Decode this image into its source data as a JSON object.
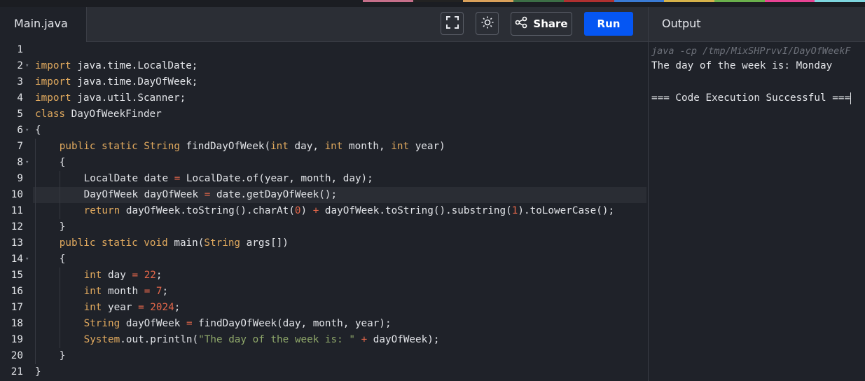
{
  "editor": {
    "file_tab": "Main.java",
    "buttons": {
      "fullscreen_icon": "fullscreen-icon",
      "theme_icon": "sun-icon",
      "share_label": "Share",
      "run_label": "Run"
    },
    "active_line": 10,
    "lines": [
      {
        "n": "1",
        "fold": false,
        "indent": 0,
        "tokens": []
      },
      {
        "n": "2",
        "fold": true,
        "indent": 0,
        "tokens": [
          [
            "kw",
            "import"
          ],
          [
            "t",
            " java.time.LocalDate;"
          ]
        ]
      },
      {
        "n": "3",
        "fold": false,
        "indent": 0,
        "tokens": [
          [
            "kw",
            "import"
          ],
          [
            "t",
            " java.time.DayOfWeek;"
          ]
        ]
      },
      {
        "n": "4",
        "fold": false,
        "indent": 0,
        "tokens": [
          [
            "kw",
            "import"
          ],
          [
            "t",
            " java.util.Scanner;"
          ]
        ]
      },
      {
        "n": "5",
        "fold": false,
        "indent": 0,
        "tokens": [
          [
            "kw",
            "class"
          ],
          [
            "t",
            " DayOfWeekFinder"
          ]
        ]
      },
      {
        "n": "6",
        "fold": true,
        "indent": 0,
        "tokens": [
          [
            "t",
            "{"
          ]
        ]
      },
      {
        "n": "7",
        "fold": false,
        "indent": 1,
        "tokens": [
          [
            "kw",
            "public static String"
          ],
          [
            "t",
            " findDayOfWeek("
          ],
          [
            "kw",
            "int"
          ],
          [
            "t",
            " day, "
          ],
          [
            "kw",
            "int"
          ],
          [
            "t",
            " month, "
          ],
          [
            "kw",
            "int"
          ],
          [
            "t",
            " year)"
          ]
        ]
      },
      {
        "n": "8",
        "fold": true,
        "indent": 1,
        "tokens": [
          [
            "t",
            "{"
          ]
        ]
      },
      {
        "n": "9",
        "fold": false,
        "indent": 2,
        "tokens": [
          [
            "t",
            "LocalDate date "
          ],
          [
            "op",
            "="
          ],
          [
            "t",
            " LocalDate.of(year, month, day);"
          ]
        ]
      },
      {
        "n": "10",
        "fold": false,
        "indent": 2,
        "tokens": [
          [
            "t",
            "DayOfWeek dayOfWeek "
          ],
          [
            "op",
            "="
          ],
          [
            "t",
            " date.getDayOfWeek();"
          ]
        ]
      },
      {
        "n": "11",
        "fold": false,
        "indent": 2,
        "tokens": [
          [
            "kw",
            "return"
          ],
          [
            "t",
            " dayOfWeek.toString().charAt("
          ],
          [
            "num",
            "0"
          ],
          [
            "t",
            ") "
          ],
          [
            "op",
            "+"
          ],
          [
            "t",
            " dayOfWeek.toString().substring("
          ],
          [
            "num",
            "1"
          ],
          [
            "t",
            ").toLowerCase();"
          ]
        ]
      },
      {
        "n": "12",
        "fold": false,
        "indent": 1,
        "tokens": [
          [
            "t",
            "}"
          ]
        ]
      },
      {
        "n": "13",
        "fold": false,
        "indent": 1,
        "tokens": [
          [
            "kw",
            "public static void"
          ],
          [
            "t",
            " main("
          ],
          [
            "kw",
            "String"
          ],
          [
            "t",
            " args[])"
          ]
        ]
      },
      {
        "n": "14",
        "fold": true,
        "indent": 1,
        "tokens": [
          [
            "t",
            "{"
          ]
        ]
      },
      {
        "n": "15",
        "fold": false,
        "indent": 2,
        "tokens": [
          [
            "kw",
            "int"
          ],
          [
            "t",
            " day "
          ],
          [
            "op",
            "="
          ],
          [
            "t",
            " "
          ],
          [
            "num",
            "22"
          ],
          [
            "t",
            ";"
          ]
        ]
      },
      {
        "n": "16",
        "fold": false,
        "indent": 2,
        "tokens": [
          [
            "kw",
            "int"
          ],
          [
            "t",
            " month "
          ],
          [
            "op",
            "="
          ],
          [
            "t",
            " "
          ],
          [
            "num",
            "7"
          ],
          [
            "t",
            ";"
          ]
        ]
      },
      {
        "n": "17",
        "fold": false,
        "indent": 2,
        "tokens": [
          [
            "kw",
            "int"
          ],
          [
            "t",
            " year "
          ],
          [
            "op",
            "="
          ],
          [
            "t",
            " "
          ],
          [
            "num",
            "2024"
          ],
          [
            "t",
            ";"
          ]
        ]
      },
      {
        "n": "18",
        "fold": false,
        "indent": 2,
        "tokens": [
          [
            "kw",
            "String"
          ],
          [
            "t",
            " dayOfWeek "
          ],
          [
            "op",
            "="
          ],
          [
            "t",
            " findDayOfWeek(day, month, year);"
          ]
        ]
      },
      {
        "n": "19",
        "fold": false,
        "indent": 2,
        "tokens": [
          [
            "kw",
            "System"
          ],
          [
            "t",
            ".out.println("
          ],
          [
            "str",
            "\"The day of the week is: \""
          ],
          [
            "t",
            " "
          ],
          [
            "op",
            "+"
          ],
          [
            "t",
            " dayOfWeek);"
          ]
        ]
      },
      {
        "n": "20",
        "fold": false,
        "indent": 1,
        "tokens": [
          [
            "t",
            "}"
          ]
        ]
      },
      {
        "n": "21",
        "fold": false,
        "indent": 0,
        "tokens": [
          [
            "t",
            "}"
          ]
        ]
      }
    ]
  },
  "output": {
    "title": "Output",
    "command": "java -cp /tmp/MixSHPrvvI/DayOfWeekF",
    "lines": [
      "The day of the week is: Monday",
      "",
      "=== Code Execution Successful ==="
    ]
  },
  "colors": {
    "run_button": "#0556f3",
    "keyword": "#e0a95e",
    "number": "#e3674a",
    "string": "#8fa86a"
  }
}
